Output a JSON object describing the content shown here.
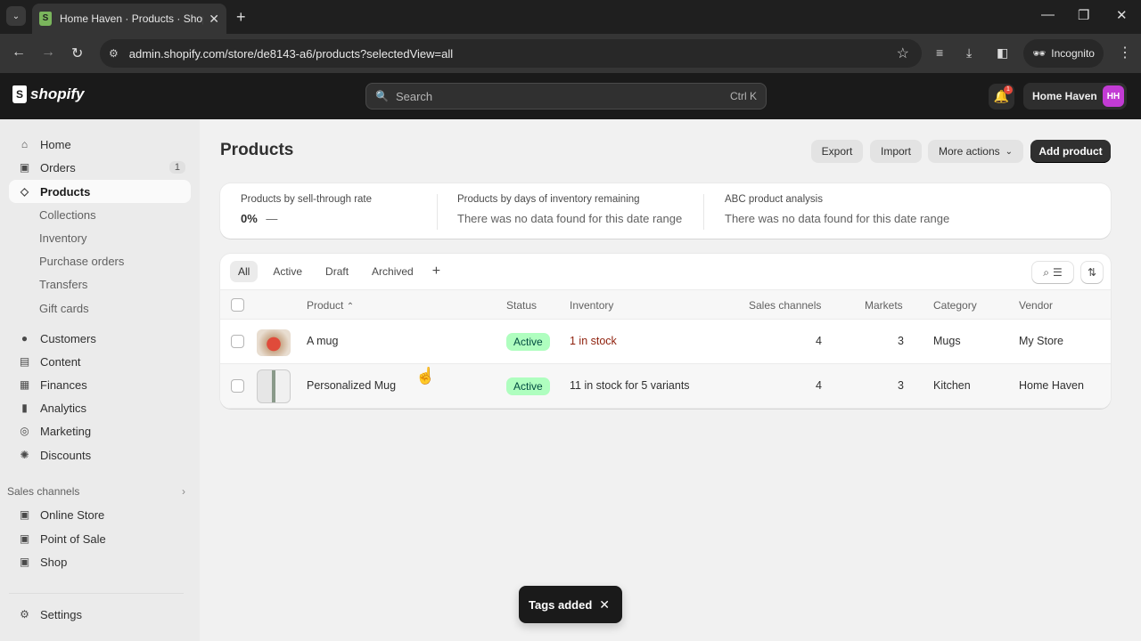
{
  "browser": {
    "tab_title": "Home Haven · Products · Shopify",
    "tab_favicon": "shopify-bag-icon",
    "new_tab": "+",
    "url": "admin.shopify.com/store/de8143-a6/products?selectedView=all",
    "incognito_label": "Incognito",
    "window_controls": {
      "minimize": "—",
      "restore": "❐",
      "close": "✕"
    }
  },
  "topbar": {
    "logo_text": "shopify",
    "search_placeholder": "Search",
    "search_shortcut": "Ctrl K",
    "notification_count": "1",
    "store_name": "Home Haven",
    "avatar_initials": "HH",
    "avatar_color": "#c23bd4"
  },
  "sidebar": {
    "items": [
      {
        "label": "Home",
        "icon": "home-icon"
      },
      {
        "label": "Orders",
        "icon": "inbox-icon",
        "badge": "1"
      },
      {
        "label": "Products",
        "icon": "tag-icon",
        "active": true
      }
    ],
    "product_subitems": [
      "Collections",
      "Inventory",
      "Purchase orders",
      "Transfers",
      "Gift cards"
    ],
    "items2": [
      {
        "label": "Customers",
        "icon": "person-icon"
      },
      {
        "label": "Content",
        "icon": "content-icon"
      },
      {
        "label": "Finances",
        "icon": "bank-icon"
      },
      {
        "label": "Analytics",
        "icon": "bar-chart-icon"
      },
      {
        "label": "Marketing",
        "icon": "target-icon"
      },
      {
        "label": "Discounts",
        "icon": "discount-icon"
      }
    ],
    "sales_channels_label": "Sales channels",
    "channels": [
      {
        "label": "Online Store",
        "icon": "store-icon"
      },
      {
        "label": "Point of Sale",
        "icon": "pos-icon"
      },
      {
        "label": "Shop",
        "icon": "shop-icon"
      }
    ],
    "settings_label": "Settings"
  },
  "page": {
    "title": "Products",
    "actions": {
      "export": "Export",
      "import": "Import",
      "more": "More actions",
      "add": "Add product"
    }
  },
  "metrics": [
    {
      "label": "Products by sell-through rate",
      "value": "0%",
      "trend": "—"
    },
    {
      "label": "Products by days of inventory remaining",
      "value": "There was no data found for this date range"
    },
    {
      "label": "ABC product analysis",
      "value": "There was no data found for this date range"
    }
  ],
  "filter_tabs": [
    "All",
    "Active",
    "Draft",
    "Archived"
  ],
  "table": {
    "columns": [
      "Product",
      "Status",
      "Inventory",
      "Sales channels",
      "Markets",
      "Category",
      "Vendor"
    ],
    "rows": [
      {
        "product": "A mug",
        "status": "Active",
        "inventory": "1 in stock",
        "low_stock": true,
        "sales_channels": "4",
        "markets": "3",
        "category": "Mugs",
        "vendor": "My Store"
      },
      {
        "product": "Personalized Mug",
        "status": "Active",
        "inventory": "11 in stock for 5 variants",
        "low_stock": false,
        "sales_channels": "4",
        "markets": "3",
        "category": "Kitchen",
        "vendor": "Home Haven"
      }
    ]
  },
  "toast": {
    "message": "Tags added",
    "close": "✕"
  }
}
